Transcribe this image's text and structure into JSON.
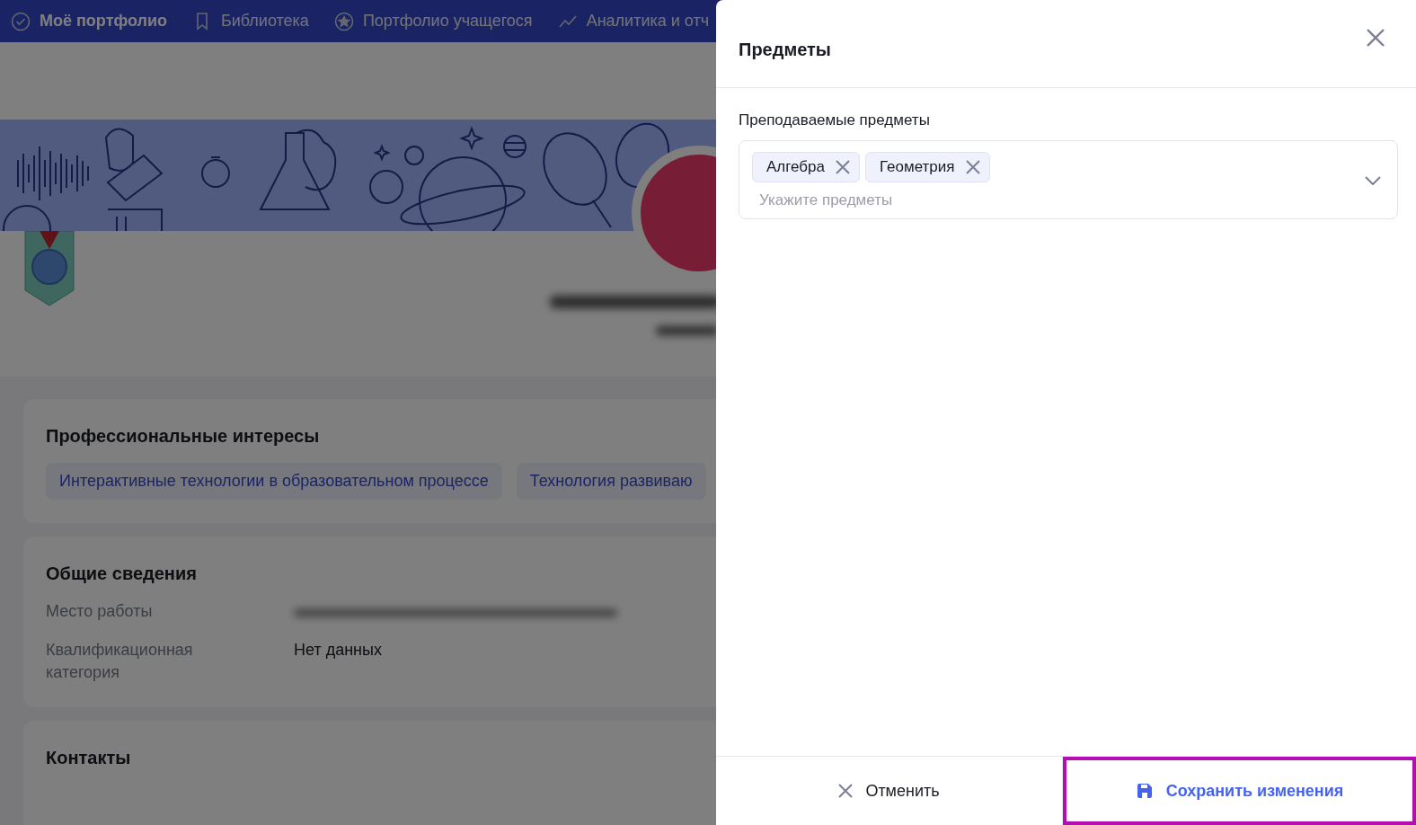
{
  "nav": {
    "items": [
      {
        "label": "Моё портфолио",
        "selected": true
      },
      {
        "label": "Библиотека",
        "selected": false
      },
      {
        "label": "Портфолио учащегося",
        "selected": false
      },
      {
        "label": "Аналитика и отч",
        "selected": false
      }
    ]
  },
  "profile": {
    "sections": [
      {
        "kind": "tags",
        "title": "Профессиональные интересы",
        "tags": [
          "Интерактивные технологии в образовательном процессе",
          "Технология развиваю"
        ]
      },
      {
        "kind": "fields",
        "title": "Общие сведения",
        "fields": [
          {
            "label": "Место работы"
          },
          {
            "label": "Квалификационная категория",
            "value": "Нет данных"
          }
        ]
      },
      {
        "kind": "empty",
        "title": "Контакты"
      }
    ]
  },
  "drawer": {
    "title": "Предметы",
    "field": {
      "label": "Преподаваемые предметы",
      "chips": [
        "Алгебра",
        "Геометрия"
      ],
      "placeholder": "Укажите предметы"
    },
    "buttons": [
      {
        "kind": "cancel",
        "label": "Отменить",
        "highlighted": false
      },
      {
        "kind": "save",
        "label": "Сохранить изменения",
        "highlighted": true
      }
    ]
  }
}
